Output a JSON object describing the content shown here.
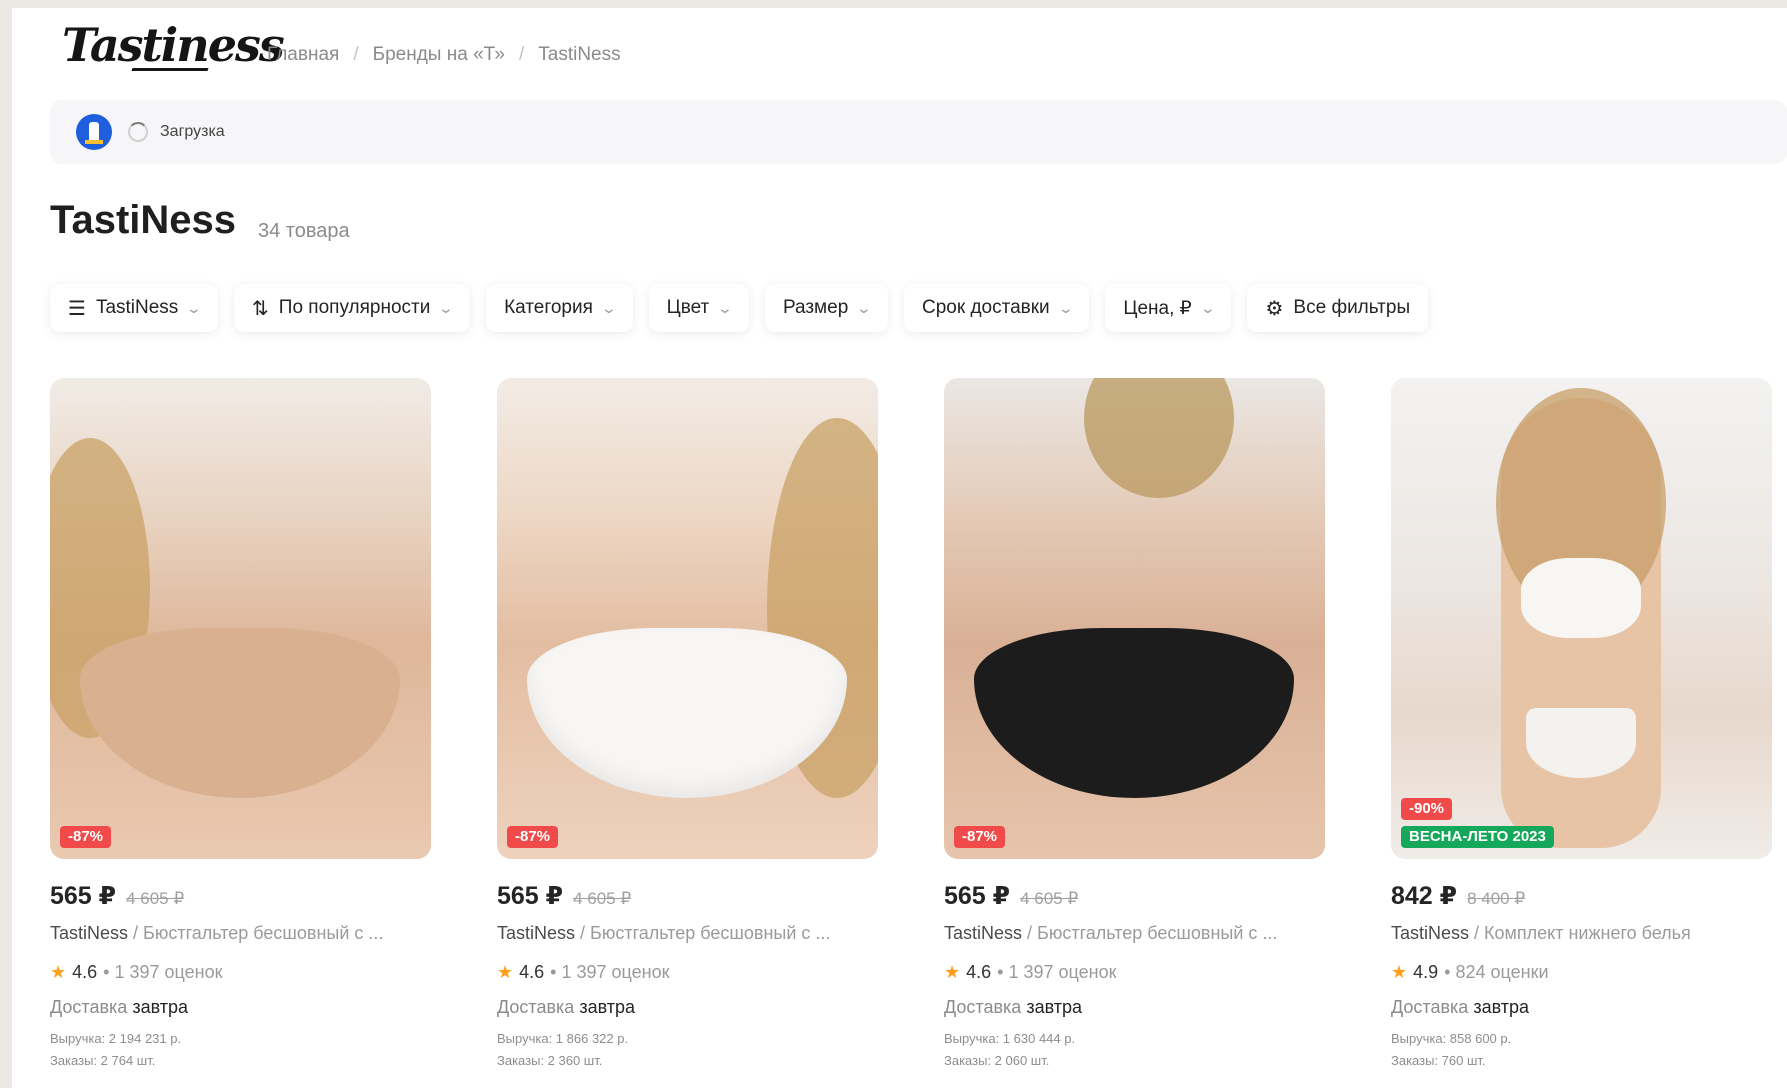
{
  "header": {
    "logo_text": "Tastiness",
    "breadcrumbs": [
      "Главная",
      "Бренды на «Т»",
      "TastiNess"
    ],
    "separator": "/"
  },
  "loading": {
    "text": "Загрузка"
  },
  "page": {
    "title": "TastiNess",
    "count": "34 товара"
  },
  "filters": [
    {
      "label": "TastiNess",
      "icon": "menu-icon"
    },
    {
      "label": "По популярности",
      "icon": "sort-icon"
    },
    {
      "label": "Категория"
    },
    {
      "label": "Цвет"
    },
    {
      "label": "Размер"
    },
    {
      "label": "Срок доставки"
    },
    {
      "label": "Цена, ₽"
    },
    {
      "label": "Все фильтры",
      "icon": "filter-sliders-icon"
    }
  ],
  "products": [
    {
      "badge": "-87%",
      "price": "565 ₽",
      "old_price": "4 605 ₽",
      "brand": "TastiNess",
      "name": " / Бюстгальтер бесшовный с ...",
      "rating": "4.6",
      "reviews": "• 1 397 оценок",
      "delivery_label": "Доставка",
      "delivery_value": "завтра",
      "revenue": "Выручка: 2 194 231 р.",
      "orders": "Заказы: 2 764 шт."
    },
    {
      "badge": "-87%",
      "price": "565 ₽",
      "old_price": "4 605 ₽",
      "brand": "TastiNess",
      "name": " / Бюстгальтер бесшовный с ...",
      "rating": "4.6",
      "reviews": "• 1 397 оценок",
      "delivery_label": "Доставка",
      "delivery_value": "завтра",
      "revenue": "Выручка: 1 866 322 р.",
      "orders": "Заказы: 2 360 шт."
    },
    {
      "badge": "-87%",
      "price": "565 ₽",
      "old_price": "4 605 ₽",
      "brand": "TastiNess",
      "name": " / Бюстгальтер бесшовный с ...",
      "rating": "4.6",
      "reviews": "• 1 397 оценок",
      "delivery_label": "Доставка",
      "delivery_value": "завтра",
      "revenue": "Выручка: 1 630 444 р.",
      "orders": "Заказы: 2 060 шт."
    },
    {
      "badge": "-90%",
      "badge2": "ВЕСНА-ЛЕТО 2023",
      "price": "842 ₽",
      "old_price": "8 400 ₽",
      "brand": "TastiNess",
      "name": " / Комплект нижнего белья",
      "rating": "4.9",
      "reviews": "• 824 оценки",
      "delivery_label": "Доставка",
      "delivery_value": "завтра",
      "revenue": "Выручка: 858 600 р.",
      "orders": "Заказы: 760 шт."
    }
  ],
  "colors": {
    "discount": "#f04a4a",
    "season": "#15a85b",
    "star": "#ff9f1c"
  }
}
